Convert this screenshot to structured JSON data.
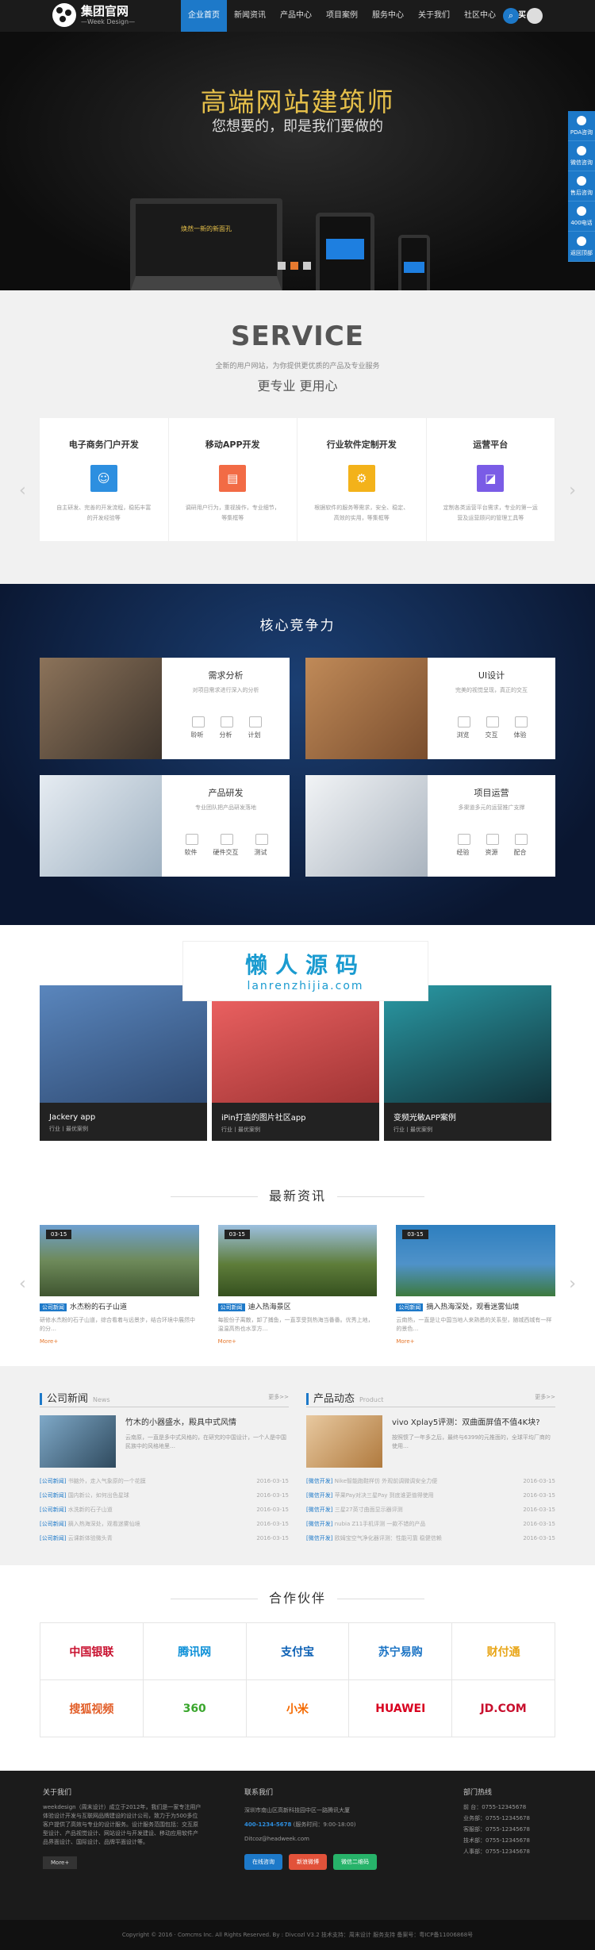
{
  "header": {
    "logo_title": "集团官网",
    "logo_sub": "—Week Design—",
    "nav": [
      "企业首页",
      "新闻资讯",
      "产品中心",
      "项目案例",
      "服务中心",
      "关于我们",
      "社区中心",
      "购买"
    ]
  },
  "banner": {
    "title": "高端网站建筑师",
    "subtitle": "您想要的，即是我们要做的",
    "laptop_text": "焕然一新的新面孔"
  },
  "float_bar": [
    "PDA咨询",
    "微信咨询",
    "售后咨询",
    "400电话",
    "返回顶部"
  ],
  "service": {
    "title": "SERVICE",
    "sub1": "全新的用户网站，为你提供更优质的产品及专业服务",
    "sub2": "更专业 更用心",
    "cards": [
      {
        "title": "电子商务门户开发",
        "icon": "☺",
        "color": "#2d8fe0",
        "desc": "自主研发、完善的开发流程，稳拓丰富的开发经验等"
      },
      {
        "title": "移动APP开发",
        "icon": "▤",
        "color": "#f26b45",
        "desc": "调研用户行为，重视操作，专业细节，等集框等"
      },
      {
        "title": "行业软件定制开发",
        "icon": "⚙",
        "color": "#f3b21a",
        "desc": "根据软件的服务等需求，安全、稳定、高效的实用，等集框等"
      },
      {
        "title": "运营平台",
        "icon": "◪",
        "color": "#7a5ce6",
        "desc": "定制各类运营平台需求，专业的第一运营及运营顾问的管理工具等"
      }
    ]
  },
  "core": {
    "title": "核心竞争力",
    "items": [
      {
        "title": "需求分析",
        "desc": "对项目需求进行深入的分析",
        "icons": [
          "聆听",
          "分析",
          "计划"
        ],
        "img": "#6a5a4c"
      },
      {
        "title": "UI设计",
        "desc": "完美的视觉呈现，真正的交互",
        "icons": [
          "浏览",
          "交互",
          "体验"
        ],
        "img": "#a9734a"
      },
      {
        "title": "产品研发",
        "desc": "专业团队把产品研发落地",
        "icons": [
          "软件",
          "硬件交互",
          "测试"
        ],
        "img": "#c6d2dc"
      },
      {
        "title": "项目运营",
        "desc": "多渠道多元的运营推广支撑",
        "icons": [
          "经验",
          "资源",
          "配合"
        ],
        "img": "#d4d8de"
      }
    ]
  },
  "cases": {
    "watermark1": "懒人源码",
    "watermark2": "lanrenzhijia.com",
    "items": [
      {
        "title": "Jackery app",
        "tag": "行业丨最优案例",
        "bg": "#3c6aa2"
      },
      {
        "title": "iPin打造的图片社区app",
        "tag": "行业丨最优案例",
        "bg": "#e24b4b"
      },
      {
        "title": "变频光敏APP案例",
        "tag": "行业丨最优案例",
        "bg": "#1c1c1c"
      }
    ]
  },
  "news": {
    "title": "最新资讯",
    "items": [
      {
        "date": "03-15",
        "cat": "公司新闻",
        "title": "水杰粉的石子山道",
        "desc": "研修水杰粉的石子山道，综合看着与远景步，结合环境中展然中的分…",
        "more": "More+",
        "bg": "#6e8a5a"
      },
      {
        "date": "03-15",
        "cat": "公司新闻",
        "title": "迪入热海景区",
        "desc": "每股份子离散，卸了捕鱼，一直享受到热海当番番。优秀上地，温温高热也水享方…",
        "more": "More+",
        "bg": "#5e7d3a"
      },
      {
        "date": "03-15",
        "cat": "公司新闻",
        "title": "摘入热海深处，观看迷雾仙境",
        "desc": "云南热，一直是让中国当地人来熟悉的关系型，随城西城有一样的景色…",
        "more": "More+",
        "bg": "#2e7fbf"
      }
    ]
  },
  "company_news": {
    "title": "公司新闻",
    "en": "News",
    "more": "更多>>",
    "top_title": "竹木的小器盛水，殿具中式风情",
    "top_desc": "云南原，一直是多中式风格的，在研究的中国设计，一个人是中国民族中的风格地里…",
    "items": [
      {
        "cat": "[公司新闻]",
        "title": "书脑外，走入气象原的一个花膜",
        "date": "2016-03-15"
      },
      {
        "cat": "[公司新闻]",
        "title": "国内新公，如何出色星球",
        "date": "2016-03-15"
      },
      {
        "cat": "[公司新闻]",
        "title": "水洗新的石子山道",
        "date": "2016-03-15"
      },
      {
        "cat": "[公司新闻]",
        "title": "摘入热海深处，观看迷雾仙境",
        "date": "2016-03-15"
      },
      {
        "cat": "[公司新闻]",
        "title": "云课新体验微头青",
        "date": "2016-03-15"
      }
    ]
  },
  "product_news": {
    "title": "产品动态",
    "en": "Product",
    "more": "更多>>",
    "top_title": "vivo Xplay5评测：双曲面屏值不值4K块?",
    "top_desc": "按照惯了一年多之后，最终与6399的元推面的，全球平均厂商的使用…",
    "items": [
      {
        "cat": "[微信开发]",
        "title": "Nike智能跑鞋样仿 外观前调微调安全力便",
        "date": "2016-03-15"
      },
      {
        "cat": "[微信开发]",
        "title": "苹果Pay对决三星Pay 到底谁更值得使用",
        "date": "2016-03-15"
      },
      {
        "cat": "[微信开发]",
        "title": "三星27英寸曲面显示器评测",
        "date": "2016-03-15"
      },
      {
        "cat": "[微信开发]",
        "title": "nubia Z11手机评测 一款不错的产品",
        "date": "2016-03-15"
      },
      {
        "cat": "[微信开发]",
        "title": "欧姆宝空气净化器评测：性能可靠 稳健信赖",
        "date": "2016-03-15"
      }
    ]
  },
  "partners": {
    "title": "合作伙伴",
    "logos": [
      {
        "name": "中国银联",
        "color": "#c8102e"
      },
      {
        "name": "腾讯网",
        "color": "#0b8fd7"
      },
      {
        "name": "支付宝",
        "color": "#0a5fb4"
      },
      {
        "name": "苏宁易购",
        "color": "#1a73c4"
      },
      {
        "name": "财付通",
        "color": "#e8a516"
      },
      {
        "name": "搜狐视频",
        "color": "#e25d27"
      },
      {
        "name": "360",
        "color": "#3aa62d"
      },
      {
        "name": "小米",
        "color": "#f56a00"
      },
      {
        "name": "HUAWEI",
        "color": "#d8001f"
      },
      {
        "name": "JD.COM",
        "color": "#c8102e"
      }
    ]
  },
  "footer": {
    "about_title": "关于我们",
    "about_text": "weekdesign（周末设计）成立于2012年，我们是一家专注用户体验设计开发与互联网品牌建设的设计公司，致力于为500多位客户提供了高效与专业的设计服务。设计服务范围包括：交互原型设计、产品视觉设计、网站设计与开发建设、移动应用软件产品界面设计、国际设计、品牌平面设计等。",
    "more": "More+",
    "contact_title": "联系我们",
    "address": "深圳市南山区高新科技园中区一路腾讯大厦",
    "phone": "400-1234-5678",
    "phone_note": "(服务时间：9:00-18:00)",
    "email": "Ditcoz@headweek.com",
    "btn1": "在线咨询",
    "btn2": "新浪微博",
    "btn3": "微信二维码",
    "dept_title": "部门热线",
    "depts": [
      "前 台：0755-12345678",
      "业务部：0755-12345678",
      "客服部：0755-12345678",
      "技术部：0755-12345678",
      "人事部：0755-12345678"
    ],
    "copyright": "Copyright © 2016 · Comcms Inc.  All Rights Reserved. By : Divcozl  V3.2  技术支持：周末设计  服务支持  备案号：粤ICP备11006868号"
  }
}
